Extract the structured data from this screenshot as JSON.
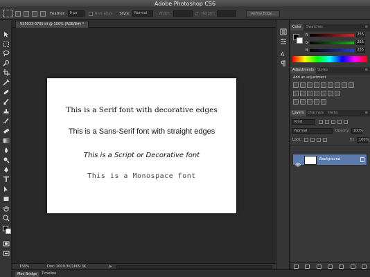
{
  "app": {
    "title": "Adobe Photoshop CS6"
  },
  "options_bar": {
    "feather_label": "Feather:",
    "feather_value": "0 px",
    "antialias_label": "Anti-alias",
    "style_label": "Style:",
    "style_value": "Normal",
    "width_label": "Width:",
    "height_label": "Height:",
    "refine_edge_label": "Refine Edge..."
  },
  "document": {
    "tab_label": "935033-0705.tif @ 150% (RGB/8#) *",
    "lines": [
      "This is a Serif font with decorative edges",
      "This is a Sans-Serif font with straight edges",
      "This is a Script or Decorative font",
      "This is a Monospace font"
    ],
    "background": "#ffffff"
  },
  "status": {
    "zoom": "150%",
    "doc_size": "Doc: 1009.3K/1009.3K"
  },
  "bottom_tabs": [
    "Mini Bridge",
    "Timeline"
  ],
  "panels": {
    "color": {
      "tabs": [
        "Color",
        "Swatches"
      ],
      "sliders": [
        {
          "key": "R",
          "value": "255",
          "color": "#e02020"
        },
        {
          "key": "G",
          "value": "255",
          "color": "#20b020"
        },
        {
          "key": "B",
          "value": "255",
          "color": "#2040e0"
        }
      ]
    },
    "adjustments": {
      "tabs": [
        "Adjustments",
        "Styles"
      ],
      "heading": "Add an adjustment"
    },
    "layers": {
      "tabs": [
        "Layers",
        "Channels",
        "Paths"
      ],
      "kind_label": "Kind",
      "blend_mode": "Normal",
      "opacity_label": "Opacity:",
      "opacity_value": "100%",
      "lock_label": "Lock:",
      "fill_label": "Fill:",
      "fill_value": "100%",
      "layer_name": "Background"
    }
  },
  "colors": {
    "accent_selection": "#5c7cb0",
    "canvas_bg": "#282828"
  }
}
